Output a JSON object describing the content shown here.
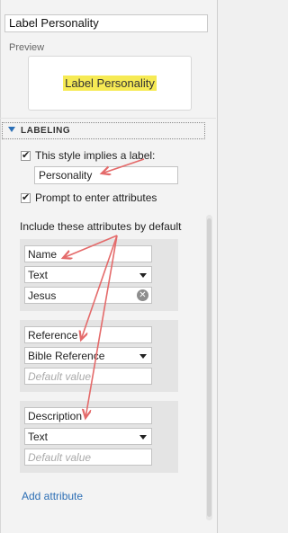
{
  "style_name_value": "Label Personality",
  "preview": {
    "label": "Preview",
    "sample_text": "Label Personality"
  },
  "section": {
    "title": "LABELING"
  },
  "implies_label": {
    "checked": true,
    "label": "This style implies a label:",
    "value": "Personality"
  },
  "prompt_attributes": {
    "checked": true,
    "label": "Prompt to enter attributes"
  },
  "include_label": "Include these attributes by default",
  "attributes": [
    {
      "name": "Name",
      "type": "Text",
      "default": "Jesus",
      "default_placeholder": ""
    },
    {
      "name": "Reference",
      "type": "Bible Reference",
      "default": "",
      "default_placeholder": "Default value"
    },
    {
      "name": "Description",
      "type": "Text",
      "default": "",
      "default_placeholder": "Default value"
    }
  ],
  "add_attribute_label": "Add attribute",
  "colors": {
    "accent_blue": "#2d6fb5",
    "highlight_yellow": "#f6ea54",
    "annotation_red": "#e46a6a"
  }
}
